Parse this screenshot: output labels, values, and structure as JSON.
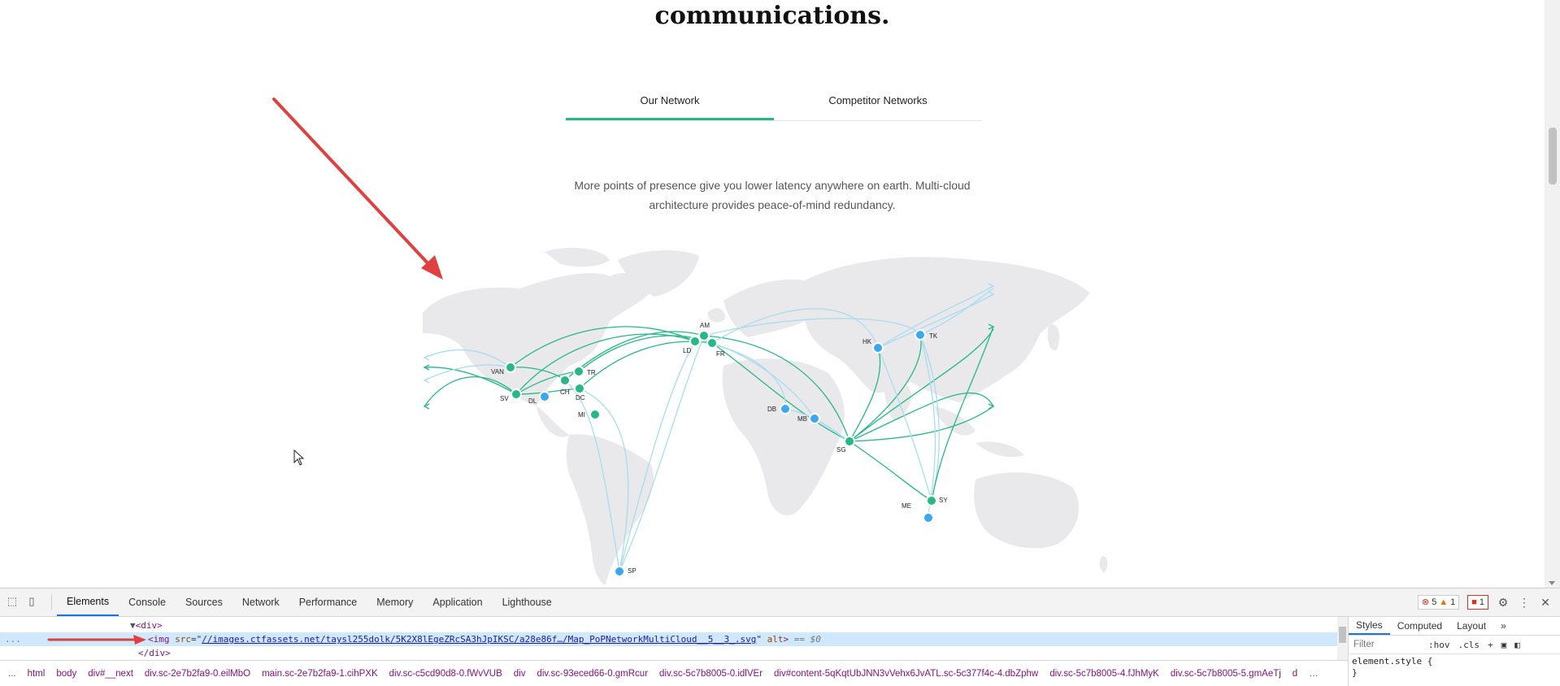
{
  "page": {
    "headline": "communications.",
    "tabs": [
      {
        "label": "Our Network",
        "active": true
      },
      {
        "label": "Competitor Networks",
        "active": false
      }
    ],
    "lead": "More points of presence give you lower latency anywhere on earth. Multi-cloud architecture provides peace-of-mind redundancy.",
    "accent_color": "#27b885",
    "secondary_color": "#3aa8f0"
  },
  "map": {
    "nodes": [
      {
        "code": "VAN",
        "type": "green"
      },
      {
        "code": "SV",
        "type": "green"
      },
      {
        "code": "DL",
        "type": "blue"
      },
      {
        "code": "CH",
        "type": "green"
      },
      {
        "code": "TR",
        "type": "green"
      },
      {
        "code": "DC",
        "type": "green"
      },
      {
        "code": "MI",
        "type": "green"
      },
      {
        "code": "SP",
        "type": "blue"
      },
      {
        "code": "LD",
        "type": "green"
      },
      {
        "code": "AM",
        "type": "green"
      },
      {
        "code": "FR",
        "type": "green"
      },
      {
        "code": "DB",
        "type": "blue"
      },
      {
        "code": "MB",
        "type": "blue"
      },
      {
        "code": "SG",
        "type": "green"
      },
      {
        "code": "HK",
        "type": "blue"
      },
      {
        "code": "TK",
        "type": "blue"
      },
      {
        "code": "SY",
        "type": "green"
      },
      {
        "code": "ME",
        "type": "blue"
      }
    ]
  },
  "devtools": {
    "tabs": [
      "Elements",
      "Console",
      "Sources",
      "Network",
      "Performance",
      "Memory",
      "Application",
      "Lighthouse"
    ],
    "active_tab": "Elements",
    "errors": "5",
    "warnings": "1",
    "issues": "1",
    "dom": {
      "line1_tag": "<div>",
      "line2_tag_open": "<img",
      "line2_attr_src": "src",
      "line2_src_value": "//images.ctfassets.net/taysl255dolk/5K2X8lEgeZRcSA3hJpIKSC/a28e86f…/Map_PoPNetworkMultiCloud__5__3_.svg",
      "line2_attr_alt": "alt",
      "line2_close": ">",
      "line2_eq": "== $0",
      "line3_tag": "</div>",
      "gutter": "..."
    },
    "styles_tabs": [
      "Styles",
      "Computed",
      "Layout"
    ],
    "styles_more": "»",
    "filter_placeholder": "Filter",
    "hov": ":hov",
    "cls": ".cls",
    "element_style": "element.style {",
    "element_style_close": "}",
    "breadcrumbs_lead": "...",
    "breadcrumbs": [
      "html",
      "body",
      "div#__next",
      "div.sc-2e7b2fa9-0.eilMbO",
      "main.sc-2e7b2fa9-1.cihPXK",
      "div.sc-c5cd90d8-0.fWvVUB",
      "div",
      "div.sc-93eced66-0.gmRcur",
      "div.sc-5c7b8005-0.idlVEr",
      "div#content-5qKqtUbJNN3vVehx6JvATL.sc-5c377f4c-4.dbZphw",
      "div.sc-5c7b8005-4.fJhMyK",
      "div.sc-5c7b8005-5.gmAeTj",
      "d"
    ],
    "breadcrumbs_trail": "…"
  }
}
